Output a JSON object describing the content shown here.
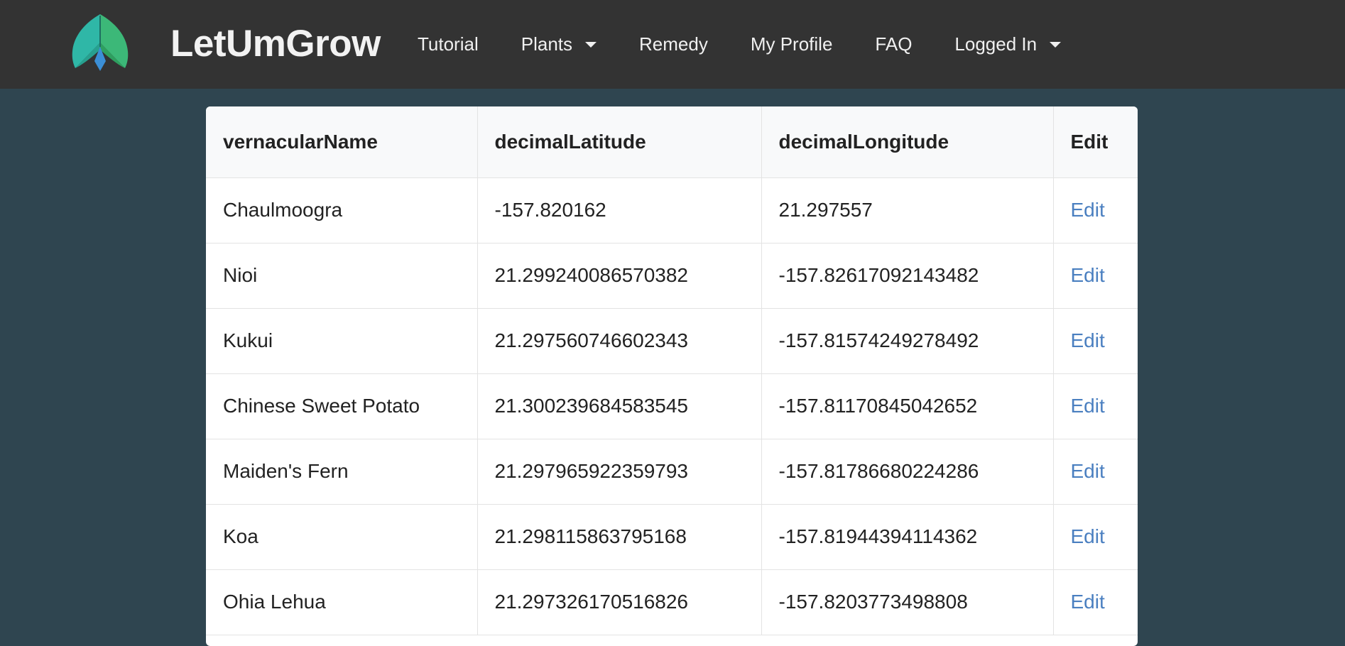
{
  "colors": {
    "navbar_bg": "#333333",
    "page_bg": "#2f4550",
    "link": "#4a7fc0",
    "logo_green": "#3cb878",
    "logo_teal": "#2fb7a7",
    "logo_blue": "#3b8fd6"
  },
  "header": {
    "brand": "LetUmGrow",
    "logo_icon": "leaf-logo-icon",
    "nav": [
      {
        "label": "Tutorial",
        "dropdown": false
      },
      {
        "label": "Plants",
        "dropdown": true
      },
      {
        "label": "Remedy",
        "dropdown": false
      },
      {
        "label": "My Profile",
        "dropdown": false
      },
      {
        "label": "FAQ",
        "dropdown": false
      },
      {
        "label": "Logged In",
        "dropdown": true
      }
    ]
  },
  "table": {
    "columns": [
      "vernacularName",
      "decimalLatitude",
      "decimalLongitude",
      "Edit"
    ],
    "rows": [
      {
        "name": "Chaulmoogra",
        "lat": "-157.820162",
        "lon": "21.297557",
        "edit": "Edit"
      },
      {
        "name": "Nioi",
        "lat": "21.299240086570382",
        "lon": "-157.82617092143482",
        "edit": "Edit"
      },
      {
        "name": "Kukui",
        "lat": "21.297560746602343",
        "lon": "-157.81574249278492",
        "edit": "Edit"
      },
      {
        "name": "Chinese Sweet Potato",
        "lat": "21.300239684583545",
        "lon": "-157.81170845042652",
        "edit": "Edit"
      },
      {
        "name": "Maiden's Fern",
        "lat": "21.297965922359793",
        "lon": "-157.81786680224286",
        "edit": "Edit"
      },
      {
        "name": "Koa",
        "lat": "21.298115863795168",
        "lon": "-157.81944394114362",
        "edit": "Edit"
      },
      {
        "name": "Ohia Lehua",
        "lat": "21.297326170516826",
        "lon": "-157.8203773498808",
        "edit": "Edit"
      }
    ]
  }
}
